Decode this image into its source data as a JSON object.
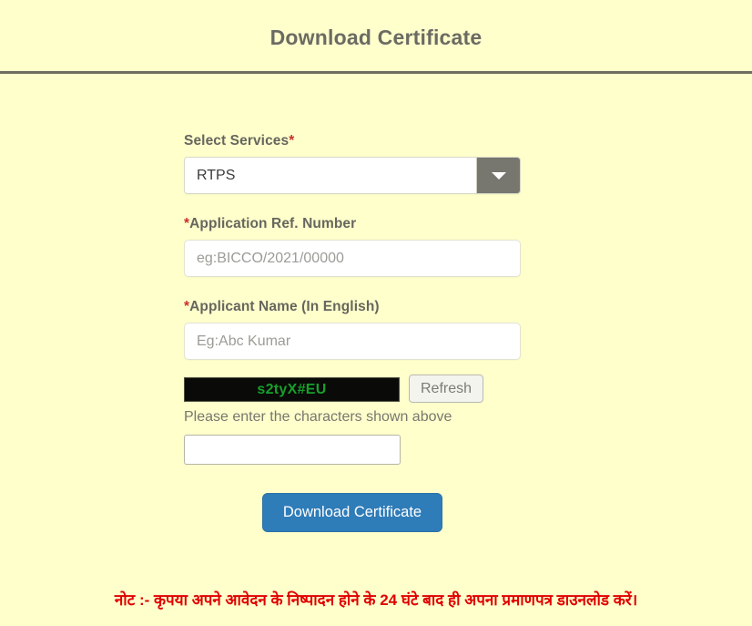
{
  "header": {
    "title": "Download Certificate"
  },
  "form": {
    "service": {
      "label": "Select Services",
      "required_mark": "*",
      "selected": "RTPS",
      "arrow_icon": "chevron-down-icon"
    },
    "ref_number": {
      "required_mark": "*",
      "label": "Application Ref. Number",
      "value": "",
      "placeholder": "eg:BICCO/2021/00000"
    },
    "applicant_name": {
      "required_mark": "*",
      "label": "Applicant Name (In English)",
      "value": "",
      "placeholder": "Eg:Abc Kumar"
    },
    "captcha": {
      "code": "s2tyX#EU",
      "refresh_label": "Refresh",
      "hint": "Please enter the characters shown above",
      "value": "",
      "placeholder": "",
      "text_color": "#16a02a",
      "background_color": "#0a0a08"
    },
    "submit": {
      "label": "Download Certificate",
      "color": "#2e7cb8"
    }
  },
  "footer": {
    "note": "नोट :- कृपया अपने आवेदन के निष्पादन होने के 24 घंटे बाद ही अपना प्रमाणपत्र डाउनलोड करें।",
    "note_color": "#e00000"
  }
}
